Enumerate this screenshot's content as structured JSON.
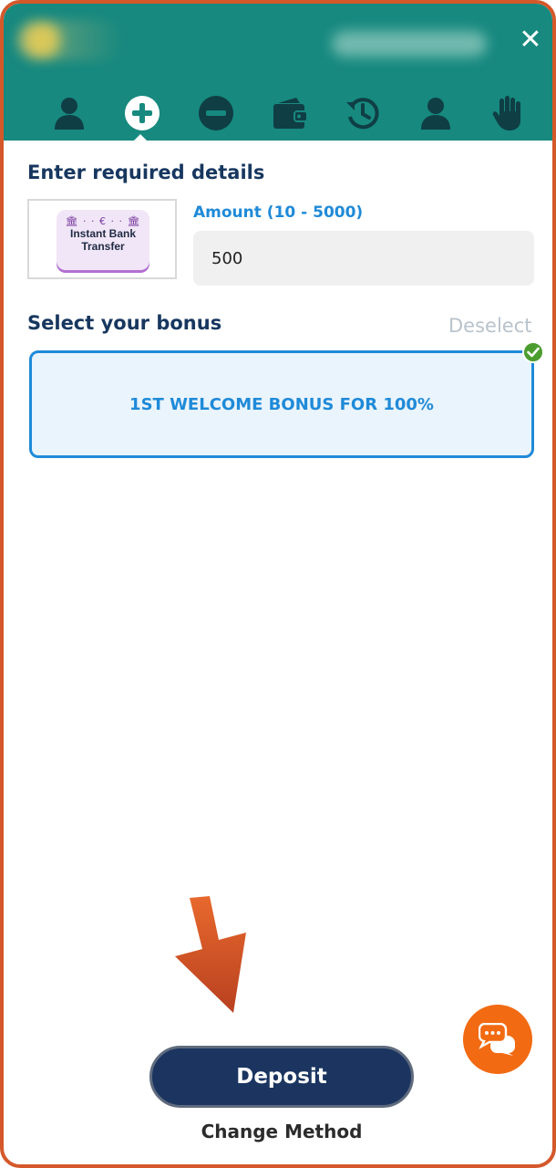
{
  "header": {
    "close_glyph": "✕",
    "nav": [
      {
        "icon": "user-icon"
      },
      {
        "icon": "plus-circle-icon",
        "active": true
      },
      {
        "icon": "minus-circle-icon"
      },
      {
        "icon": "wallet-icon"
      },
      {
        "icon": "history-icon"
      },
      {
        "icon": "user-icon"
      },
      {
        "icon": "hand-icon"
      }
    ],
    "colors": {
      "background": "#17897f",
      "icon": "#0f3e45"
    }
  },
  "details": {
    "title": "Enter required details",
    "method": {
      "top": "€",
      "line1": "Instant Bank",
      "line2": "Transfer"
    },
    "amount_label": "Amount (10 - 5000)",
    "amount_value": "500"
  },
  "bonus": {
    "title": "Select your bonus",
    "deselect_label": "Deselect",
    "selected_label": "1ST WELCOME BONUS FOR 100%",
    "selected": true
  },
  "actions": {
    "deposit_label": "Deposit",
    "change_method_label": "Change Method"
  },
  "chat": {
    "icon": "chat-bubbles-icon",
    "color": "#f26a12"
  },
  "annotation": {
    "icon": "down-arrow-icon",
    "color": "#d4582a"
  }
}
